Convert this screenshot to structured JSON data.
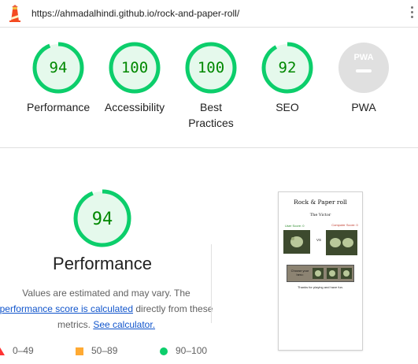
{
  "browser": {
    "url": "https://ahmadalhindi.github.io/rock-and-paper-roll/"
  },
  "categories": [
    {
      "label": "Performance",
      "score": "94"
    },
    {
      "label": "Accessibility",
      "score": "100"
    },
    {
      "label": "Best Practices",
      "score": "100"
    },
    {
      "label": "SEO",
      "score": "92"
    },
    {
      "label": "PWA",
      "badge": "PWA"
    }
  ],
  "detail": {
    "score": "94",
    "score_fraction": 0.94,
    "title": "Performance",
    "desc_line1": "Values are estimated and may vary. The",
    "desc_link1": "performance score is calculated",
    "desc_mid": " directly from these",
    "desc_line3_pre": "metrics. ",
    "desc_link2": "See calculator."
  },
  "legend": [
    {
      "range": "0–49",
      "shape": "triangle",
      "color": "#ff3333"
    },
    {
      "range": "50–89",
      "shape": "square",
      "color": "#ffaa33"
    },
    {
      "range": "90–100",
      "shape": "circle",
      "color": "#0cce6b"
    }
  ],
  "screenshot": {
    "title": "Rock & Paper roll",
    "subtitle": "The Victor",
    "user_score": "User Score: 0",
    "computer_score": "Computer Score: 0",
    "vs": "VS",
    "choose": "Choose your hero:",
    "thanks": "Thanks for playing and have fun."
  },
  "colors": {
    "pass": "#0cce6b",
    "pass_text": "#008800",
    "pass_bg": "#e5f9ec",
    "pwa_bg": "#e0e0e0",
    "pwa_text": "#ffffff",
    "link": "#1155cc"
  },
  "icons": {
    "app": "lighthouse-icon",
    "menu": "kebab-menu-icon"
  }
}
